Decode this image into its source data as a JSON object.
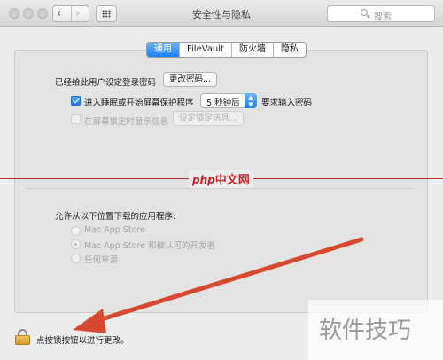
{
  "window": {
    "title": "安全性与隐私",
    "search_placeholder": "搜索"
  },
  "tabs": [
    {
      "label": "通用",
      "active": true
    },
    {
      "label": "FileVault",
      "active": false
    },
    {
      "label": "防火墙",
      "active": false
    },
    {
      "label": "隐私",
      "active": false
    }
  ],
  "general": {
    "password_set_label": "已经给此用户设定登录密码",
    "change_password_button": "更改密码...",
    "require_password_checkbox_label": "进入睡眠或开始屏幕保护程序",
    "require_password_checked": true,
    "require_password_delay": "5 秒钟后",
    "require_password_suffix": "要求输入密码",
    "lock_message_checkbox_label": "在屏幕锁定时显示信息",
    "lock_message_checked": false,
    "set_lock_message_button": "设定锁定信息..."
  },
  "downloads": {
    "heading": "允许从以下位置下载的应用程序:",
    "options": [
      {
        "label": "Mac App Store",
        "selected": false
      },
      {
        "label": "Mac App Store 和被认可的开发者",
        "selected": true
      },
      {
        "label": "任何来源",
        "selected": false
      }
    ]
  },
  "footer": {
    "lock_text": "点按锁按钮以进行更改。"
  },
  "watermarks": {
    "center_prefix": "php",
    "center_suffix": "中文网",
    "corner": "软件技巧"
  },
  "colors": {
    "accent": "#1a82fb",
    "annotation": "#d6492f"
  }
}
